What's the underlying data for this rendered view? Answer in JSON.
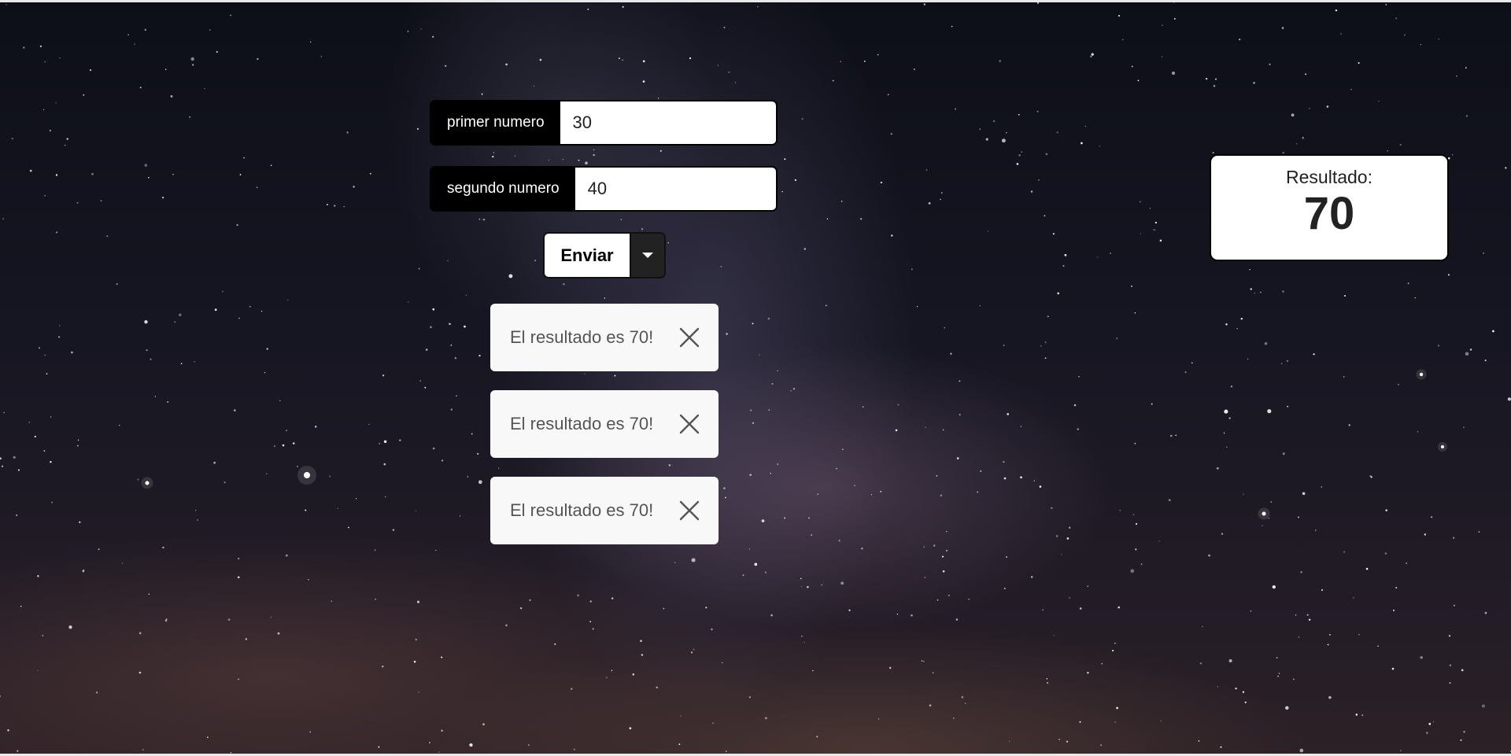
{
  "form": {
    "first": {
      "label": "primer numero",
      "value": "30"
    },
    "second": {
      "label": "segundo numero",
      "value": "40"
    },
    "submit_label": "Enviar"
  },
  "toasts": [
    {
      "message": "El resultado es 70!"
    },
    {
      "message": "El resultado es 70!"
    },
    {
      "message": "El resultado es 70!"
    }
  ],
  "result": {
    "label": "Resultado:",
    "value": "70"
  },
  "icons": {
    "dropdown": "caret-down-icon",
    "close": "close-icon"
  },
  "colors": {
    "input_label_bg": "#000000",
    "toast_bg": "#f8f8f8",
    "dropdown_bg": "#222222"
  }
}
